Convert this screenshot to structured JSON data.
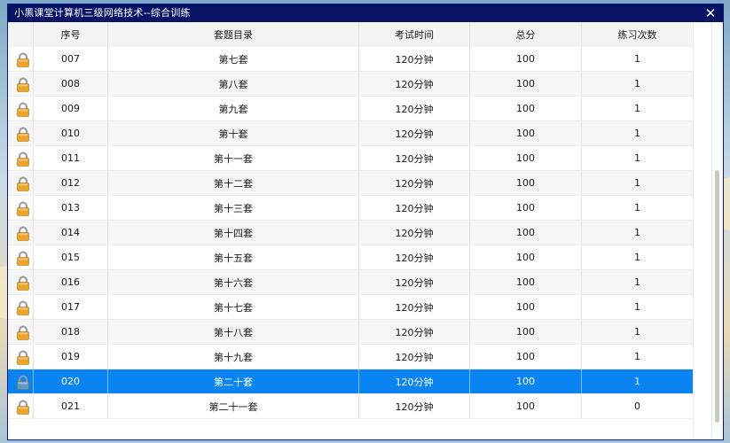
{
  "window": {
    "title": "小黑课堂计算机三级网络技术--综合训练",
    "close_glyph": "✕"
  },
  "table": {
    "columns": [
      "序号",
      "套题目录",
      "考试时间",
      "总分",
      "练习次数"
    ],
    "selected_index": 13,
    "rows": [
      {
        "no": "007",
        "name": "第七套",
        "time": "120分钟",
        "score": "100",
        "count": "1",
        "icon": "lock-icon"
      },
      {
        "no": "008",
        "name": "第八套",
        "time": "120分钟",
        "score": "100",
        "count": "1",
        "icon": "lock-icon"
      },
      {
        "no": "009",
        "name": "第九套",
        "time": "120分钟",
        "score": "100",
        "count": "1",
        "icon": "lock-icon"
      },
      {
        "no": "010",
        "name": "第十套",
        "time": "120分钟",
        "score": "100",
        "count": "1",
        "icon": "lock-icon"
      },
      {
        "no": "011",
        "name": "第十一套",
        "time": "120分钟",
        "score": "100",
        "count": "1",
        "icon": "lock-icon"
      },
      {
        "no": "012",
        "name": "第十二套",
        "time": "120分钟",
        "score": "100",
        "count": "1",
        "icon": "lock-icon"
      },
      {
        "no": "013",
        "name": "第十三套",
        "time": "120分钟",
        "score": "100",
        "count": "1",
        "icon": "lock-icon"
      },
      {
        "no": "014",
        "name": "第十四套",
        "time": "120分钟",
        "score": "100",
        "count": "1",
        "icon": "lock-icon"
      },
      {
        "no": "015",
        "name": "第十五套",
        "time": "120分钟",
        "score": "100",
        "count": "1",
        "icon": "lock-icon"
      },
      {
        "no": "016",
        "name": "第十六套",
        "time": "120分钟",
        "score": "100",
        "count": "1",
        "icon": "lock-icon"
      },
      {
        "no": "017",
        "name": "第十七套",
        "time": "120分钟",
        "score": "100",
        "count": "1",
        "icon": "lock-icon"
      },
      {
        "no": "018",
        "name": "第十八套",
        "time": "120分钟",
        "score": "100",
        "count": "1",
        "icon": "lock-icon"
      },
      {
        "no": "019",
        "name": "第十九套",
        "time": "120分钟",
        "score": "100",
        "count": "1",
        "icon": "lock-icon"
      },
      {
        "no": "020",
        "name": "第二十套",
        "time": "120分钟",
        "score": "100",
        "count": "1",
        "icon": "lock-icon"
      },
      {
        "no": "021",
        "name": "第二十一套",
        "time": "120分钟",
        "score": "100",
        "count": "0",
        "icon": "lock-icon"
      }
    ]
  },
  "colors": {
    "titlebar": "#0a1466",
    "selected_row": "#0a84f2",
    "lock_body": "#e8a52a",
    "lock_body_selected": "#5a9cc9"
  },
  "scroll": {
    "position_fraction": 0.9
  }
}
